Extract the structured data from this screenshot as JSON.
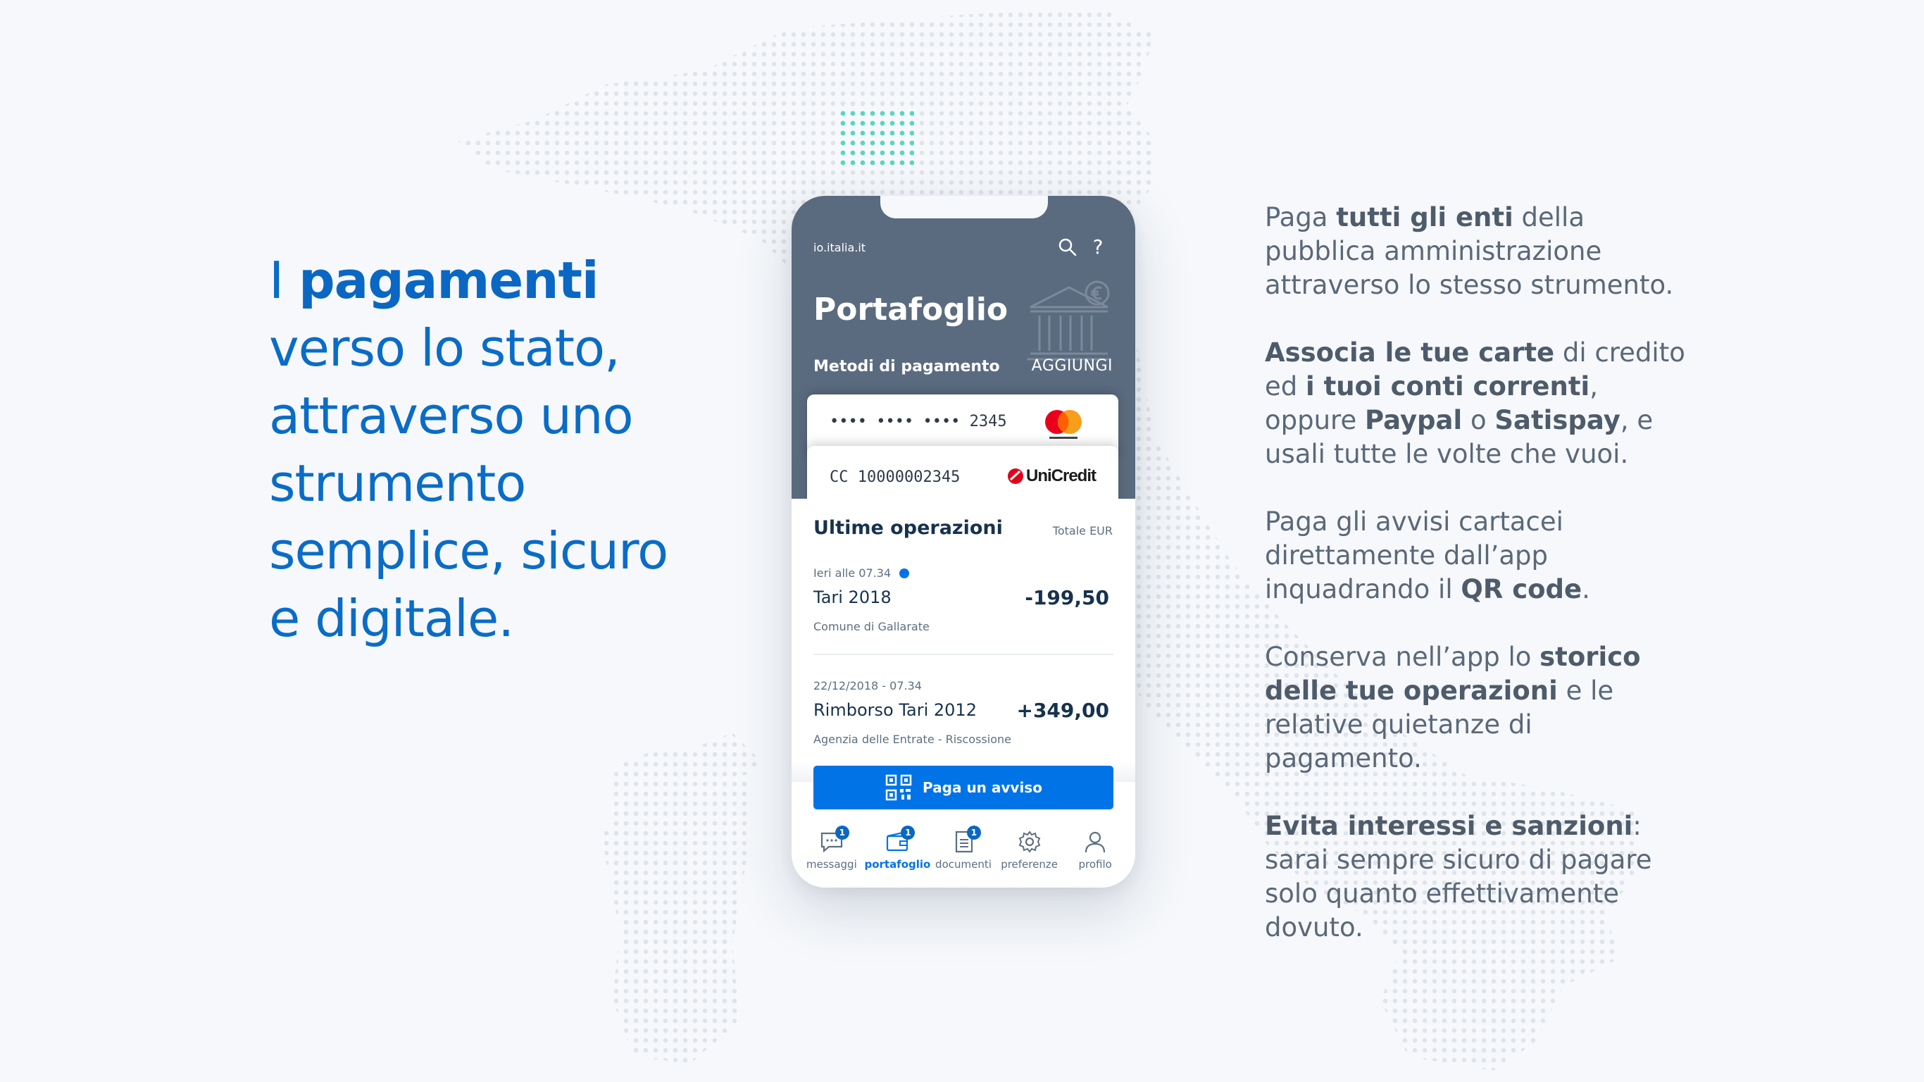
{
  "headline": {
    "line1_pre": "I ",
    "line1_bold": "pagamenti",
    "line2": "verso lo stato,",
    "line3": "attraverso uno",
    "line4": "strumento",
    "line5": "semplice, sicuro",
    "line6": "e digitale."
  },
  "copy": {
    "p1": {
      "a": "Paga ",
      "b": "tutti gli enti",
      "c": " della pubblica amministrazione attraverso lo stesso strumento."
    },
    "p2": {
      "a": "Associa le tue carte",
      "b": " di credito ed ",
      "c": "i tuoi conti correnti",
      "d": ", oppure ",
      "e": "Paypal",
      "f": " o ",
      "g": "Satispay",
      "h": ", e usali tutte le volte che vuoi."
    },
    "p3": {
      "a": "Paga gli avvisi cartacei direttamente dall’app inquadrando il ",
      "b": "QR code",
      "c": "."
    },
    "p4": {
      "a": "Conserva nell’app lo ",
      "b": "storico delle tue operazioni",
      "c": " e le relative quietanze di pagamento."
    },
    "p5": {
      "a": "Evita interessi e sanzioni",
      "b": ": sarai sempre sicuro di pagare solo quanto effettivamente dovuto."
    }
  },
  "phone": {
    "domain": "io.italia.it",
    "help": "?",
    "title": "Portafoglio",
    "methods_label": "Metodi di pagamento",
    "add_label": "AGGIUNGI",
    "cards": [
      {
        "number": "•••• •••• •••• 2345",
        "brand": "mastercard"
      },
      {
        "number": "CC 10000002345",
        "brand": "UniCredit"
      }
    ],
    "ops_title": "Ultime operazioni",
    "ops_total": "Totale EUR",
    "operations": [
      {
        "date": "Ieri alle 07.34",
        "name": "Tari 2018",
        "amount": "-199,50",
        "sub": "Comune di Gallarate"
      },
      {
        "date": "22/12/2018 - 07.34",
        "name": "Rimborso Tari 2012",
        "amount": "+349,00",
        "sub": "Agenzia delle Entrate - Riscossione"
      }
    ],
    "pay_button": "Paga un avviso",
    "tabs": [
      {
        "label": "messaggi",
        "badge": "1",
        "icon": "message-icon"
      },
      {
        "label": "portafoglio",
        "badge": "1",
        "icon": "wallet-icon"
      },
      {
        "label": "documenti",
        "badge": "1",
        "icon": "document-icon"
      },
      {
        "label": "preferenze",
        "icon": "gear-icon"
      },
      {
        "label": "profilo",
        "icon": "user-icon"
      }
    ]
  },
  "colors": {
    "primary_blue": "#0073e6",
    "headline_blue": "#0a6cc6",
    "header_slate": "#5b6b7f",
    "copy_grey": "#5a6878",
    "accent_teal": "#3fd4b8"
  }
}
